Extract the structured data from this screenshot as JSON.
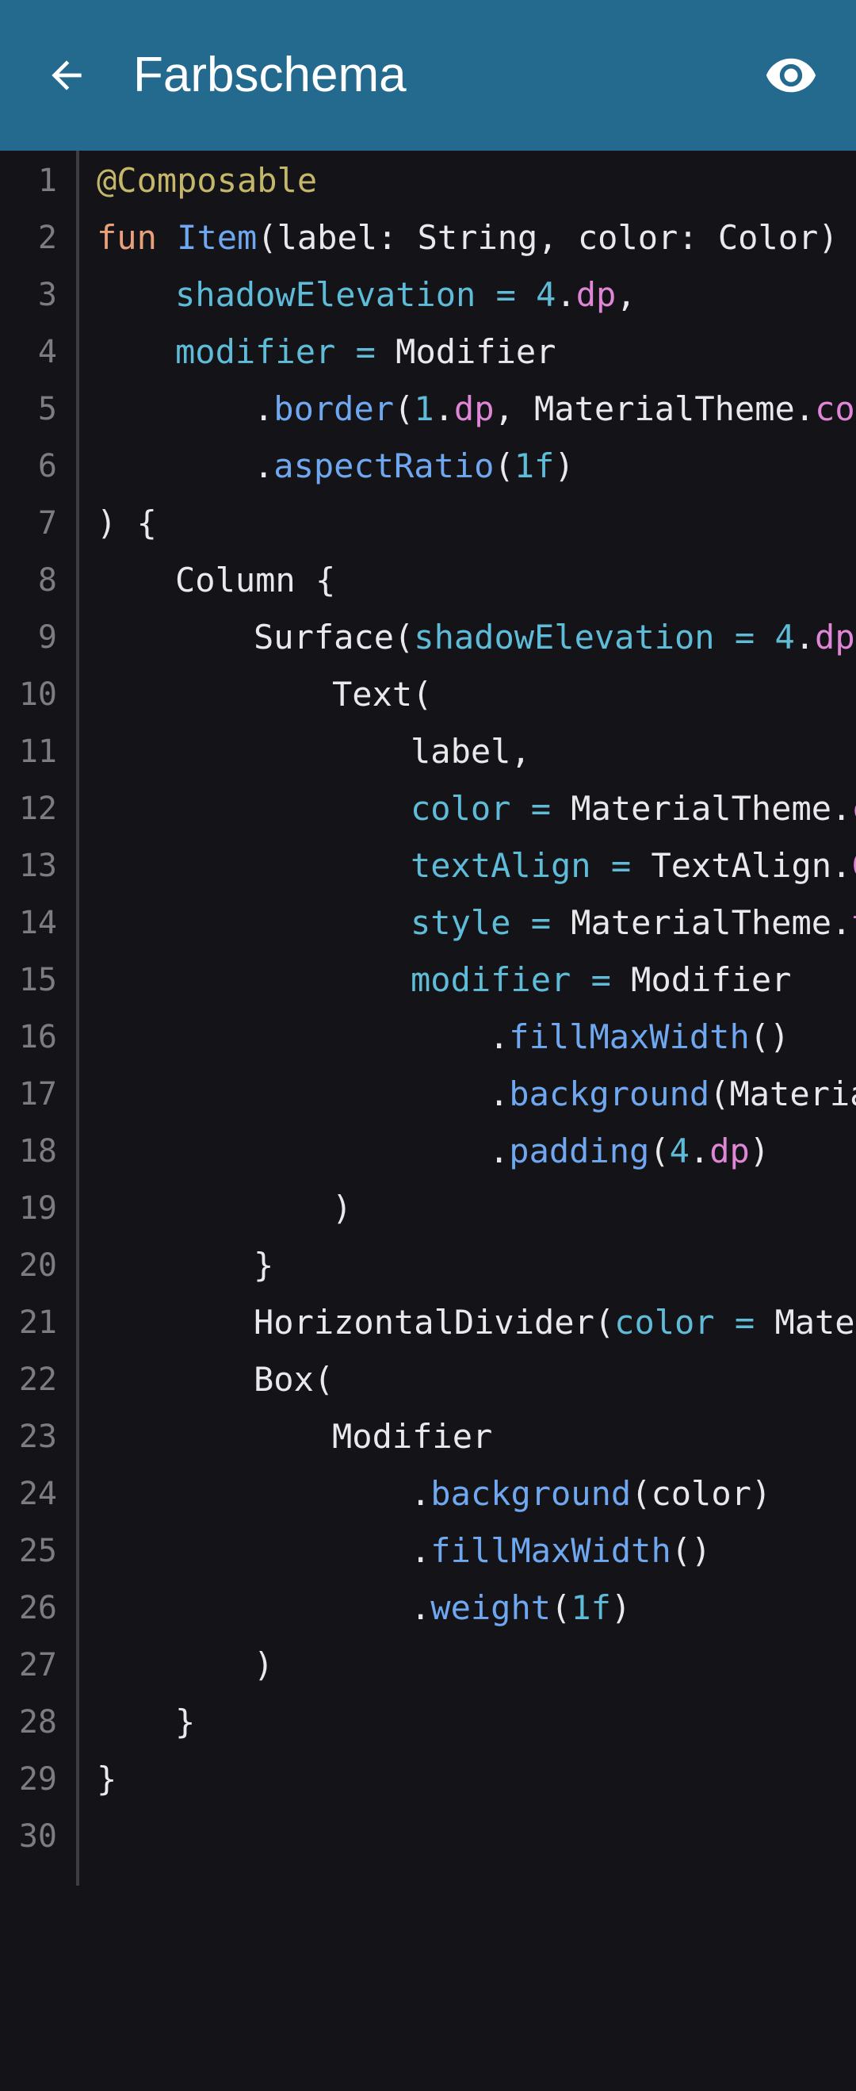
{
  "app_bar": {
    "title": "Farbschema",
    "back_icon": "arrow-left-icon",
    "preview_icon": "eye-icon",
    "background": "#246a8f"
  },
  "editor": {
    "background": "#141418",
    "lines": [
      {
        "n": "1",
        "indent": 0,
        "tokens": [
          {
            "t": "@Composable",
            "k": "ann"
          }
        ]
      },
      {
        "n": "2",
        "indent": 0,
        "tokens": [
          {
            "t": "fun ",
            "k": "kw"
          },
          {
            "t": "Item",
            "k": "fn"
          },
          {
            "t": "(label: String, color: Color) =",
            "k": "plain"
          }
        ]
      },
      {
        "n": "3",
        "indent": 1,
        "tokens": [
          {
            "t": "shadowElevation",
            "k": "param"
          },
          {
            "t": " = ",
            "k": "param"
          },
          {
            "t": "4",
            "k": "num"
          },
          {
            "t": ".",
            "k": "plain"
          },
          {
            "t": "dp",
            "k": "unit"
          },
          {
            "t": ",",
            "k": "plain"
          }
        ]
      },
      {
        "n": "4",
        "indent": 1,
        "tokens": [
          {
            "t": "modifier",
            "k": "param"
          },
          {
            "t": " = ",
            "k": "param"
          },
          {
            "t": "Modifier",
            "k": "plain"
          }
        ]
      },
      {
        "n": "5",
        "indent": 2,
        "tokens": [
          {
            "t": ".",
            "k": "plain"
          },
          {
            "t": "border",
            "k": "fn"
          },
          {
            "t": "(",
            "k": "plain"
          },
          {
            "t": "1",
            "k": "num"
          },
          {
            "t": ".",
            "k": "plain"
          },
          {
            "t": "dp",
            "k": "unit"
          },
          {
            "t": ", MaterialTheme.",
            "k": "plain"
          },
          {
            "t": "col",
            "k": "unit"
          }
        ]
      },
      {
        "n": "6",
        "indent": 2,
        "tokens": [
          {
            "t": ".",
            "k": "plain"
          },
          {
            "t": "aspectRatio",
            "k": "fn"
          },
          {
            "t": "(",
            "k": "plain"
          },
          {
            "t": "1f",
            "k": "num"
          },
          {
            "t": ")",
            "k": "plain"
          }
        ]
      },
      {
        "n": "7",
        "indent": 0,
        "tokens": [
          {
            "t": ") {",
            "k": "plain"
          }
        ]
      },
      {
        "n": "8",
        "indent": 1,
        "tokens": [
          {
            "t": "Column {",
            "k": "plain"
          }
        ]
      },
      {
        "n": "9",
        "indent": 2,
        "tokens": [
          {
            "t": "Surface(",
            "k": "plain"
          },
          {
            "t": "shadowElevation",
            "k": "param"
          },
          {
            "t": " = ",
            "k": "param"
          },
          {
            "t": "4",
            "k": "num"
          },
          {
            "t": ".",
            "k": "plain"
          },
          {
            "t": "dp",
            "k": "unit"
          },
          {
            "t": ",",
            "k": "plain"
          }
        ]
      },
      {
        "n": "10",
        "indent": 3,
        "tokens": [
          {
            "t": "Text(",
            "k": "plain"
          }
        ]
      },
      {
        "n": "11",
        "indent": 4,
        "tokens": [
          {
            "t": "label,",
            "k": "plain"
          }
        ]
      },
      {
        "n": "12",
        "indent": 4,
        "tokens": [
          {
            "t": "color",
            "k": "param"
          },
          {
            "t": " = ",
            "k": "param"
          },
          {
            "t": "MaterialTheme.",
            "k": "plain"
          },
          {
            "t": "c",
            "k": "unit"
          }
        ]
      },
      {
        "n": "13",
        "indent": 4,
        "tokens": [
          {
            "t": "textAlign",
            "k": "param"
          },
          {
            "t": " = ",
            "k": "param"
          },
          {
            "t": "TextAlign.",
            "k": "plain"
          },
          {
            "t": "C",
            "k": "unit"
          }
        ]
      },
      {
        "n": "14",
        "indent": 4,
        "tokens": [
          {
            "t": "style",
            "k": "param"
          },
          {
            "t": " = ",
            "k": "param"
          },
          {
            "t": "MaterialTheme.",
            "k": "plain"
          },
          {
            "t": "t",
            "k": "unit"
          }
        ]
      },
      {
        "n": "15",
        "indent": 4,
        "tokens": [
          {
            "t": "modifier",
            "k": "param"
          },
          {
            "t": " = ",
            "k": "param"
          },
          {
            "t": "Modifier",
            "k": "plain"
          }
        ]
      },
      {
        "n": "16",
        "indent": 5,
        "tokens": [
          {
            "t": ".",
            "k": "plain"
          },
          {
            "t": "fillMaxWidth",
            "k": "fn"
          },
          {
            "t": "()",
            "k": "plain"
          }
        ]
      },
      {
        "n": "17",
        "indent": 5,
        "tokens": [
          {
            "t": ".",
            "k": "plain"
          },
          {
            "t": "background",
            "k": "fn"
          },
          {
            "t": "(Materia",
            "k": "plain"
          }
        ]
      },
      {
        "n": "18",
        "indent": 5,
        "tokens": [
          {
            "t": ".",
            "k": "plain"
          },
          {
            "t": "padding",
            "k": "fn"
          },
          {
            "t": "(",
            "k": "plain"
          },
          {
            "t": "4",
            "k": "num"
          },
          {
            "t": ".",
            "k": "plain"
          },
          {
            "t": "dp",
            "k": "unit"
          },
          {
            "t": ")",
            "k": "plain"
          }
        ]
      },
      {
        "n": "19",
        "indent": 3,
        "tokens": [
          {
            "t": ")",
            "k": "plain"
          }
        ]
      },
      {
        "n": "20",
        "indent": 2,
        "tokens": [
          {
            "t": "}",
            "k": "plain"
          }
        ]
      },
      {
        "n": "21",
        "indent": 2,
        "tokens": [
          {
            "t": "HorizontalDivider(",
            "k": "plain"
          },
          {
            "t": "color",
            "k": "param"
          },
          {
            "t": " = ",
            "k": "param"
          },
          {
            "t": "Mater",
            "k": "plain"
          }
        ]
      },
      {
        "n": "22",
        "indent": 2,
        "tokens": [
          {
            "t": "Box(",
            "k": "plain"
          }
        ]
      },
      {
        "n": "23",
        "indent": 3,
        "tokens": [
          {
            "t": "Modifier",
            "k": "plain"
          }
        ]
      },
      {
        "n": "24",
        "indent": 4,
        "tokens": [
          {
            "t": ".",
            "k": "plain"
          },
          {
            "t": "background",
            "k": "fn"
          },
          {
            "t": "(color)",
            "k": "plain"
          }
        ]
      },
      {
        "n": "25",
        "indent": 4,
        "tokens": [
          {
            "t": ".",
            "k": "plain"
          },
          {
            "t": "fillMaxWidth",
            "k": "fn"
          },
          {
            "t": "()",
            "k": "plain"
          }
        ]
      },
      {
        "n": "26",
        "indent": 4,
        "tokens": [
          {
            "t": ".",
            "k": "plain"
          },
          {
            "t": "weight",
            "k": "fn"
          },
          {
            "t": "(",
            "k": "plain"
          },
          {
            "t": "1f",
            "k": "num"
          },
          {
            "t": ")",
            "k": "plain"
          }
        ]
      },
      {
        "n": "27",
        "indent": 2,
        "tokens": [
          {
            "t": ")",
            "k": "plain"
          }
        ]
      },
      {
        "n": "28",
        "indent": 1,
        "tokens": [
          {
            "t": "}",
            "k": "plain"
          }
        ]
      },
      {
        "n": "29",
        "indent": 0,
        "tokens": [
          {
            "t": "}",
            "k": "plain"
          }
        ]
      },
      {
        "n": "30",
        "indent": 0,
        "tokens": []
      }
    ]
  }
}
